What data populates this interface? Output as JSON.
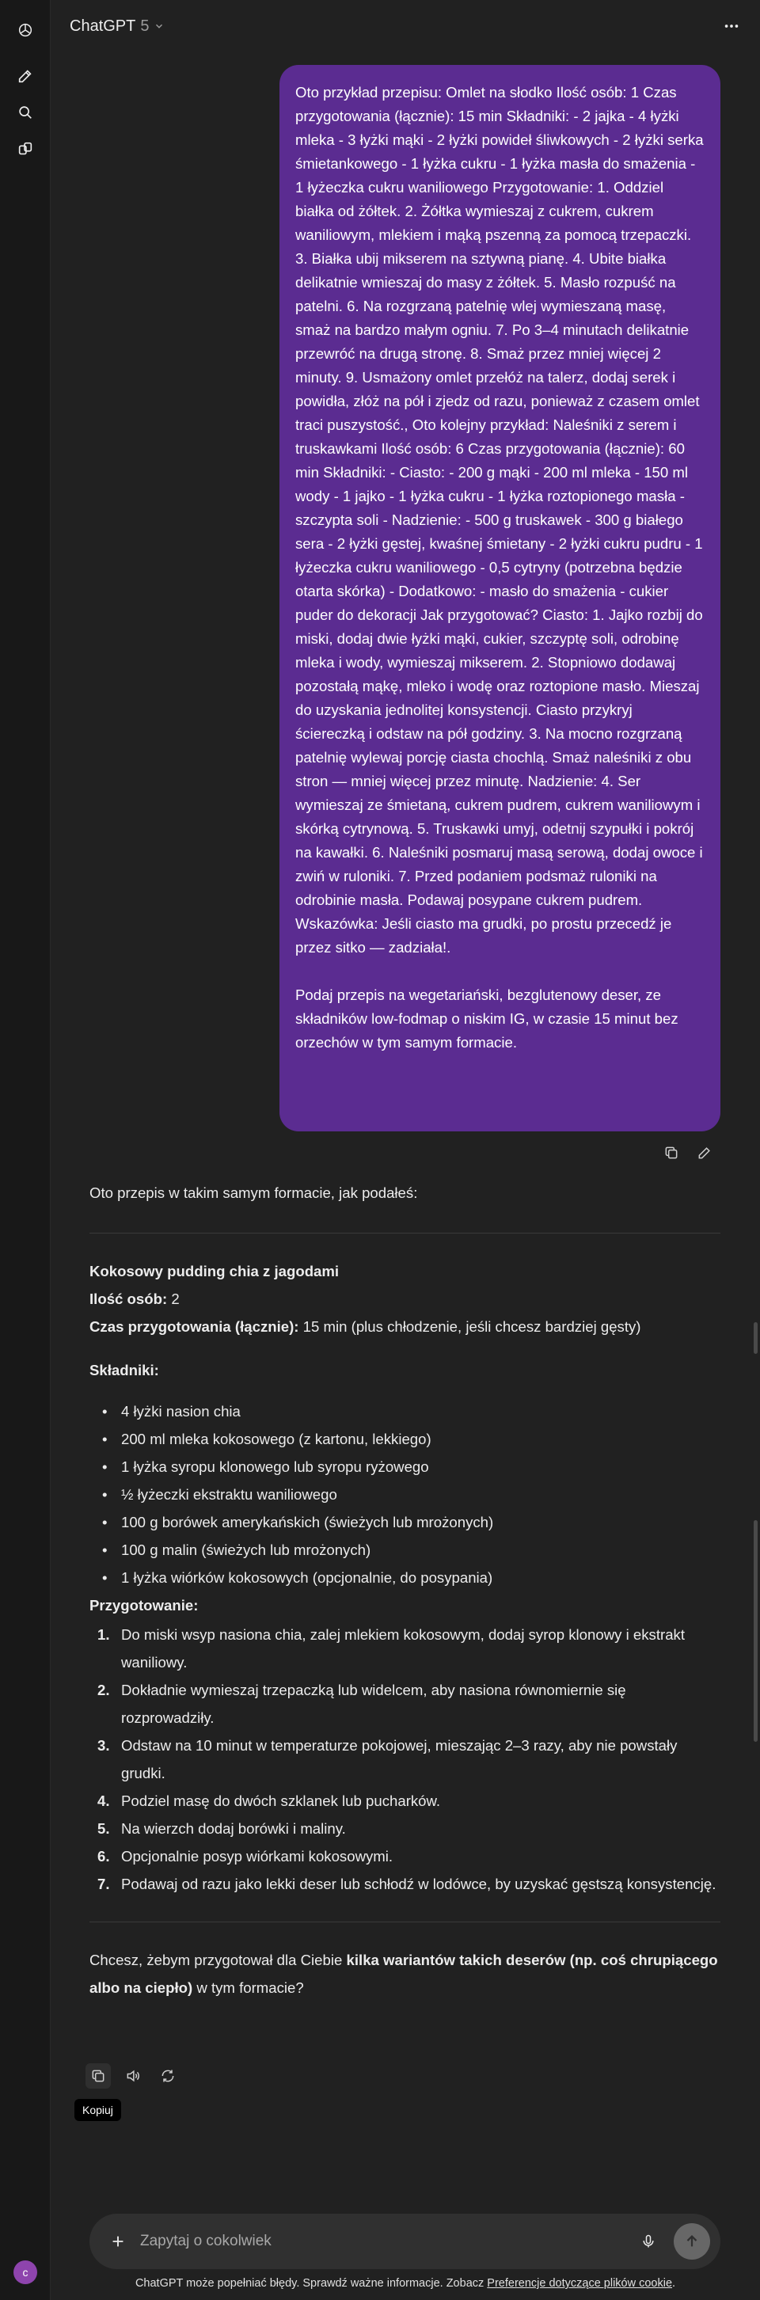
{
  "header": {
    "model_name": "ChatGPT",
    "model_version": "5",
    "more_icon": "ellipsis-icon"
  },
  "rail": {
    "icons": [
      "openai-logo-icon",
      "new-chat-icon",
      "search-icon",
      "library-icon"
    ],
    "avatar_letter": "c"
  },
  "user_message": {
    "paragraph1": "Oto przykład przepisu: Omlet na słodko Ilość osób: 1 Czas przygotowania (łącznie): 15 min Składniki: - 2 jajka - 4 łyżki mleka - 3 łyżki mąki - 2 łyżki powideł śliwkowych - 2 łyżki serka śmietankowego - 1 łyżka cukru - 1 łyżka masła do smażenia - 1 łyżeczka cukru waniliowego Przygotowanie: 1. Oddziel białka od żółtek. 2. Żółtka wymieszaj z cukrem, cukrem waniliowym, mlekiem i mąką pszenną za pomocą trzepaczki. 3. Białka ubij mikserem na sztywną pianę. 4. Ubite białka delikatnie wmieszaj do masy z żółtek. 5. Masło rozpuść na patelni. 6. Na rozgrzaną patelnię wlej wymieszaną masę, smaż na bardzo małym ogniu. 7. Po 3–4 minutach delikatnie przewróć na drugą stronę. 8. Smaż przez mniej więcej 2 minuty. 9. Usmażony omlet przełóż na talerz, dodaj serek i powidła, złóż na pół i zjedz od razu, ponieważ z czasem omlet traci puszystość., Oto kolejny przykład: Naleśniki z serem i truskawkami Ilość osób: 6 Czas przygotowania (łącznie): 60 min Składniki: - Ciasto: - 200 g mąki - 200 ml mleka - 150 ml wody - 1 jajko - 1 łyżka cukru - 1 łyżka roztopionego masła - szczypta soli - Nadzienie: - 500 g truskawek - 300 g białego sera - 2 łyżki gęstej, kwaśnej śmietany - 2 łyżki cukru pudru - 1 łyżeczka cukru waniliowego - 0,5 cytryny (potrzebna będzie otarta skórka) - Dodatkowo: - masło do smażenia - cukier puder do dekoracji Jak przygotować? Ciasto: 1. Jajko rozbij do miski, dodaj dwie łyżki mąki, cukier, szczyptę soli, odrobinę mleka i wody, wymieszaj mikserem. 2. Stopniowo dodawaj pozostałą mąkę, mleko i wodę oraz roztopione masło. Mieszaj do uzyskania jednolitej konsystencji. Ciasto przykryj ściereczką i odstaw na pół godziny. 3. Na mocno rozgrzaną patelnię wylewaj porcję ciasta chochlą. Smaż naleśniki z obu stron — mniej więcej przez minutę. Nadzienie: 4. Ser wymieszaj ze śmietaną, cukrem pudrem, cukrem waniliowym i skórką cytrynową. 5. Truskawki umyj, odetnij szypułki i pokrój na kawałki. 6. Naleśniki posmaruj masą serową, dodaj owoce i zwiń w ruloniki. 7. Przed podaniem podsmaż ruloniki na odrobinie masła. Podawaj posypane cukrem pudrem. Wskazówka: Jeśli ciasto ma grudki, po prostu przecedź je przez sitko — zadziała!.",
    "paragraph2": "Podaj przepis na wegetariański, bezglutenowy deser, ze składników low-fodmap o niskim IG, w czasie 15 minut bez orzechów w tym samym formacie.",
    "actions": [
      "copy-icon",
      "edit-icon"
    ]
  },
  "assistant_message": {
    "intro": "Oto przepis w takim samym formacie, jak podałeś:",
    "title": "Kokosowy pudding chia z jagodami",
    "servings_label": "Ilość osób:",
    "servings_value": "2",
    "time_label": "Czas przygotowania (łącznie):",
    "time_value": "15 min (plus chłodzenie, jeśli chcesz bardziej gęsty)",
    "ingredients_heading": "Składniki:",
    "ingredients": [
      "4 łyżki nasion chia",
      "200 ml mleka kokosowego (z kartonu, lekkiego)",
      "1 łyżka syropu klonowego lub syropu ryżowego",
      "½ łyżeczki ekstraktu waniliowego",
      "100 g borówek amerykańskich (świeżych lub mrożonych)",
      "100 g malin (świeżych lub mrożonych)",
      "1 łyżka wiórków kokosowych (opcjonalnie, do posypania)"
    ],
    "steps_heading": "Przygotowanie:",
    "steps": [
      {
        "num": "1.",
        "text": "Do miski wsyp nasiona chia, zalej mlekiem kokosowym, dodaj syrop klonowy i ekstrakt waniliowy."
      },
      {
        "num": "2.",
        "text": "Dokładnie wymieszaj trzepaczką lub widelcem, aby nasiona równomiernie się rozprowadziły."
      },
      {
        "num": "3.",
        "text": "Odstaw na 10 minut w temperaturze pokojowej, mieszając 2–3 razy, aby nie powstały grudki."
      },
      {
        "num": "4.",
        "text": "Podziel masę do dwóch szklanek lub pucharków."
      },
      {
        "num": "5.",
        "text": "Na wierzch dodaj borówki i maliny."
      },
      {
        "num": "6.",
        "text": "Opcjonalnie posyp wiórkami kokosowymi."
      },
      {
        "num": "7.",
        "text": "Podawaj od razu jako lekki deser lub schłodź w lodówce, by uzyskać gęstszą konsystencję."
      }
    ],
    "followup_pre": "Chcesz, żebym przygotował dla Ciebie ",
    "followup_bold": "kilka wariantów takich deserów (np. coś chrupiącego albo na ciepło)",
    "followup_post": " w tym formacie?",
    "actions": [
      "copy-icon",
      "speaker-icon",
      "regenerate-icon"
    ],
    "tooltip": "Kopiuj"
  },
  "composer": {
    "placeholder": "Zapytaj o cokolwiek"
  },
  "footer": {
    "text": "ChatGPT może popełniać błędy. Sprawdź ważne informacje. Zobacz ",
    "link": "Preferencje dotyczące plików cookie",
    "end": "."
  }
}
